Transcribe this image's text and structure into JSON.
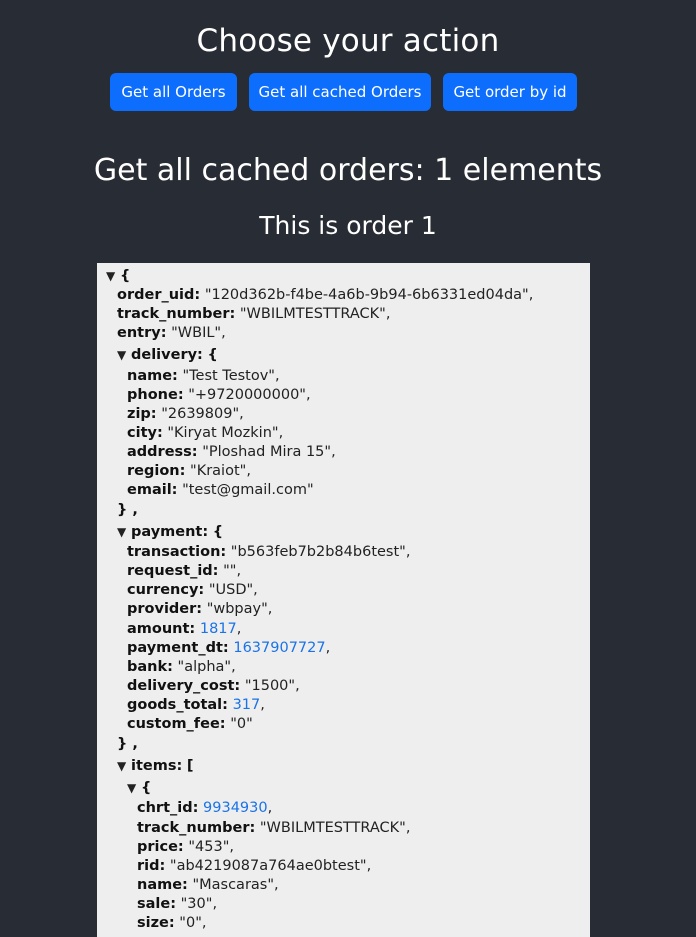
{
  "header": {
    "title": "Choose your action",
    "buttons": {
      "all_orders": "Get all Orders",
      "all_cached": "Get all cached Orders",
      "by_id": "Get order by id"
    }
  },
  "result": {
    "heading": "Get all cached orders: 1 elements",
    "order_title": "This is order 1"
  },
  "json_view": {
    "toggle": "▼",
    "root_open": "{",
    "order": {
      "order_uid": "\"120d362b-f4be-4a6b-9b94-6b6331ed04da\"",
      "track_number": "\"WBILMTESTTRACK\"",
      "entry": "\"WBIL\""
    },
    "delivery": {
      "name": "\"Test Testov\"",
      "phone": "\"+9720000000\"",
      "zip": "\"2639809\"",
      "city": "\"Kiryat Mozkin\"",
      "address": "\"Ploshad Mira 15\"",
      "region": "\"Kraiot\"",
      "email": "\"test@gmail.com\""
    },
    "payment": {
      "transaction": "\"b563feb7b2b84b6test\"",
      "request_id": "\"\"",
      "currency": "\"USD\"",
      "provider": "\"wbpay\"",
      "amount": "1817",
      "payment_dt": "1637907727",
      "bank": "\"alpha\"",
      "delivery_cost": "\"1500\"",
      "goods_total": "317",
      "custom_fee": "\"0\""
    },
    "items": [
      {
        "chrt_id": "9934930",
        "track_number": "\"WBILMTESTTRACK\"",
        "price": "\"453\"",
        "rid": "\"ab4219087a764ae0btest\"",
        "name": "\"Mascaras\"",
        "sale": "\"30\"",
        "size": "\"0\""
      }
    ]
  }
}
